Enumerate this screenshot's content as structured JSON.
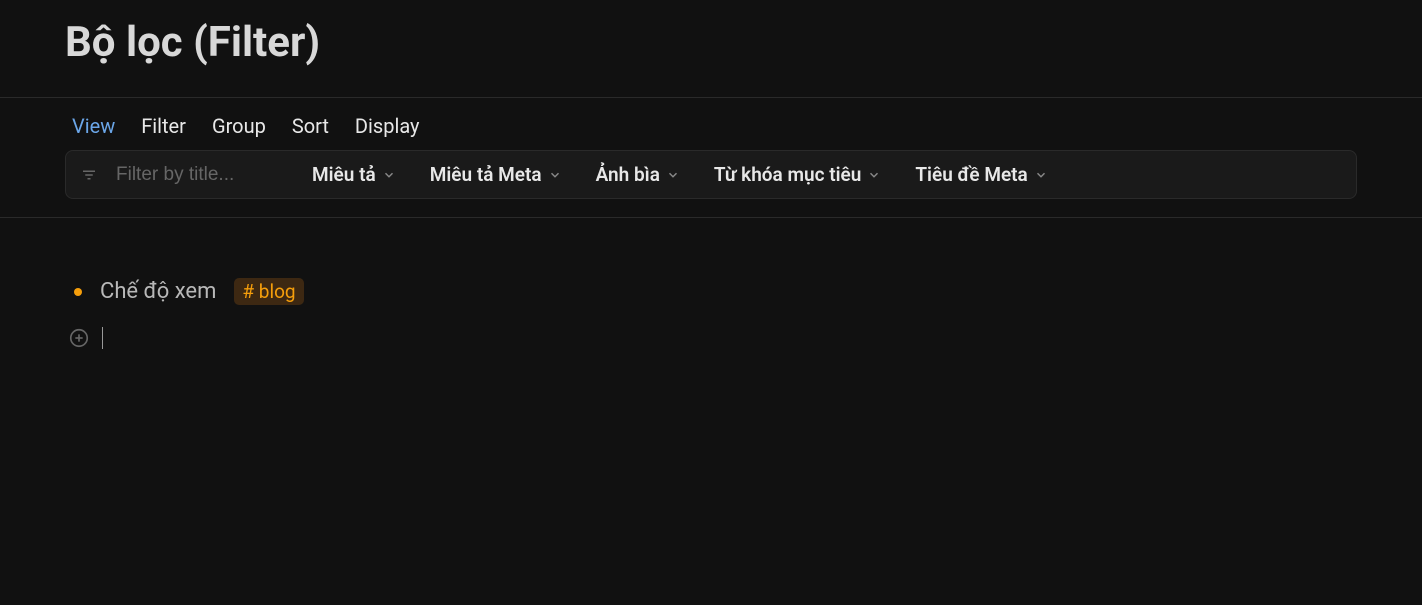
{
  "header": {
    "title": "Bộ lọc (Filter)"
  },
  "tabs": [
    {
      "label": "View",
      "active": true
    },
    {
      "label": "Filter",
      "active": false
    },
    {
      "label": "Group",
      "active": false
    },
    {
      "label": "Sort",
      "active": false
    },
    {
      "label": "Display",
      "active": false
    }
  ],
  "filterBar": {
    "placeholder": "Filter by title...",
    "chips": [
      {
        "label": "Miêu tả"
      },
      {
        "label": "Miêu tả Meta"
      },
      {
        "label": "Ảnh bìa"
      },
      {
        "label": "Từ khóa mục tiêu"
      },
      {
        "label": "Tiêu đề Meta"
      }
    ]
  },
  "content": {
    "items": [
      {
        "text": "Chế độ xem",
        "tag": "# blog"
      }
    ]
  }
}
